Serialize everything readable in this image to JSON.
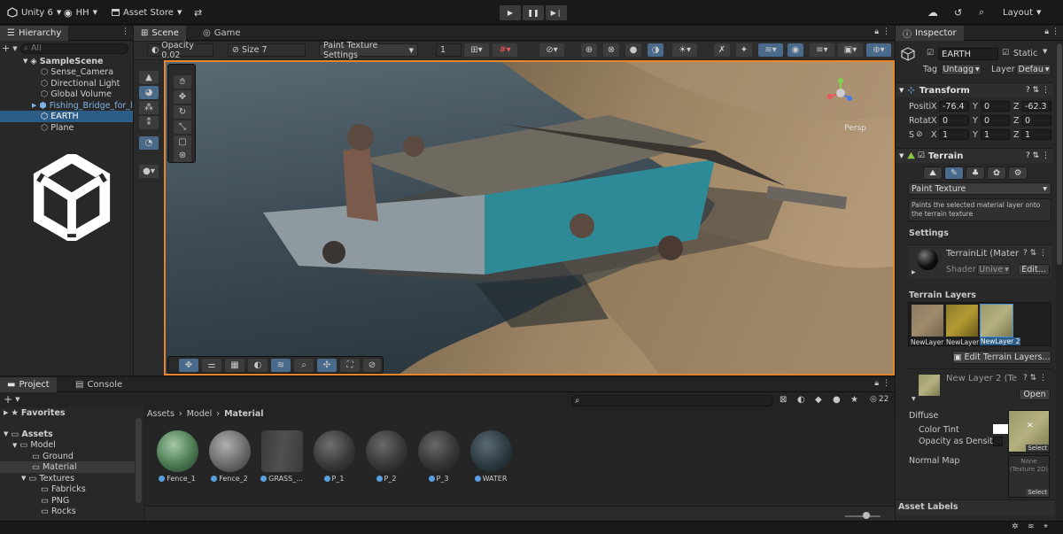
{
  "topbar": {
    "app_title": "Unity 6",
    "account": "HH",
    "asset_store": "Asset Store",
    "layout": "Layout"
  },
  "hierarchy": {
    "tab": "Hierarchy",
    "search_placeholder": "All",
    "scene": "SampleScene",
    "items": [
      "Sense_Camera",
      "Directional Light",
      "Global Volume",
      "Fishing_Bridge_for_l",
      "EARTH",
      "Plane"
    ]
  },
  "scene_view": {
    "tab_scene": "Scene",
    "tab_game": "Game",
    "opacity": "Opacity 0.02",
    "size": "Size 7",
    "paint_settings": "Paint Texture Settings",
    "brush_count": "1",
    "persp": "Persp"
  },
  "project": {
    "tab_project": "Project",
    "tab_console": "Console",
    "favorites": "Favorites",
    "assets": "Assets",
    "tree": [
      "Model",
      "Ground",
      "Material",
      "Textures",
      "Fabricks",
      "PNG",
      "Rocks"
    ],
    "breadcrumb": [
      "Assets",
      "Model",
      "Material"
    ],
    "count": "22",
    "materials": [
      "Fence_1",
      "Fence_2",
      "GRASS_...",
      "P_1",
      "P_2",
      "P_3",
      "WATER"
    ]
  },
  "inspector": {
    "tab": "Inspector",
    "object_name": "EARTH",
    "static_label": "Static",
    "tag_label": "Tag",
    "tag_value": "Untagg",
    "layer_label": "Layer",
    "layer_value": "Defau",
    "transform": {
      "title": "Transform",
      "position_label": "Positi",
      "rotation_label": "Rotat",
      "scale_label": "S",
      "x_axis": "X",
      "y_axis": "Y",
      "z_axis": "Z",
      "position": [
        "-76.4",
        "0",
        "-62.3"
      ],
      "rotation": [
        "0",
        "0",
        "0"
      ],
      "scale": [
        "1",
        "1",
        "1"
      ]
    },
    "terrain": {
      "title": "Terrain",
      "mode": "Paint Texture",
      "help": "Paints the selected material layer onto the terrain texture",
      "settings": "Settings",
      "material": "TerrainLit (Mater",
      "shader_label": "Shader",
      "shader_value": "Unive",
      "edit": "Edit...",
      "layers_title": "Terrain Layers",
      "layers": [
        "NewLayer",
        "NewLayer",
        "NewLayer 2"
      ],
      "edit_layers": "Edit Terrain Layers...",
      "layer_name": "New Layer 2 (Te",
      "open": "Open",
      "diffuse": "Diffuse",
      "color_tint": "Color Tint",
      "opacity_density": "Opacity as Density",
      "normal_map": "Normal Map",
      "select": "Select",
      "none": "None",
      "texture2d": "(Texture 2D)",
      "asset_labels": "Asset Labels"
    }
  },
  "colors": {
    "selection": "#2c5d87",
    "accent": "#f08a24",
    "panel": "#282828"
  }
}
